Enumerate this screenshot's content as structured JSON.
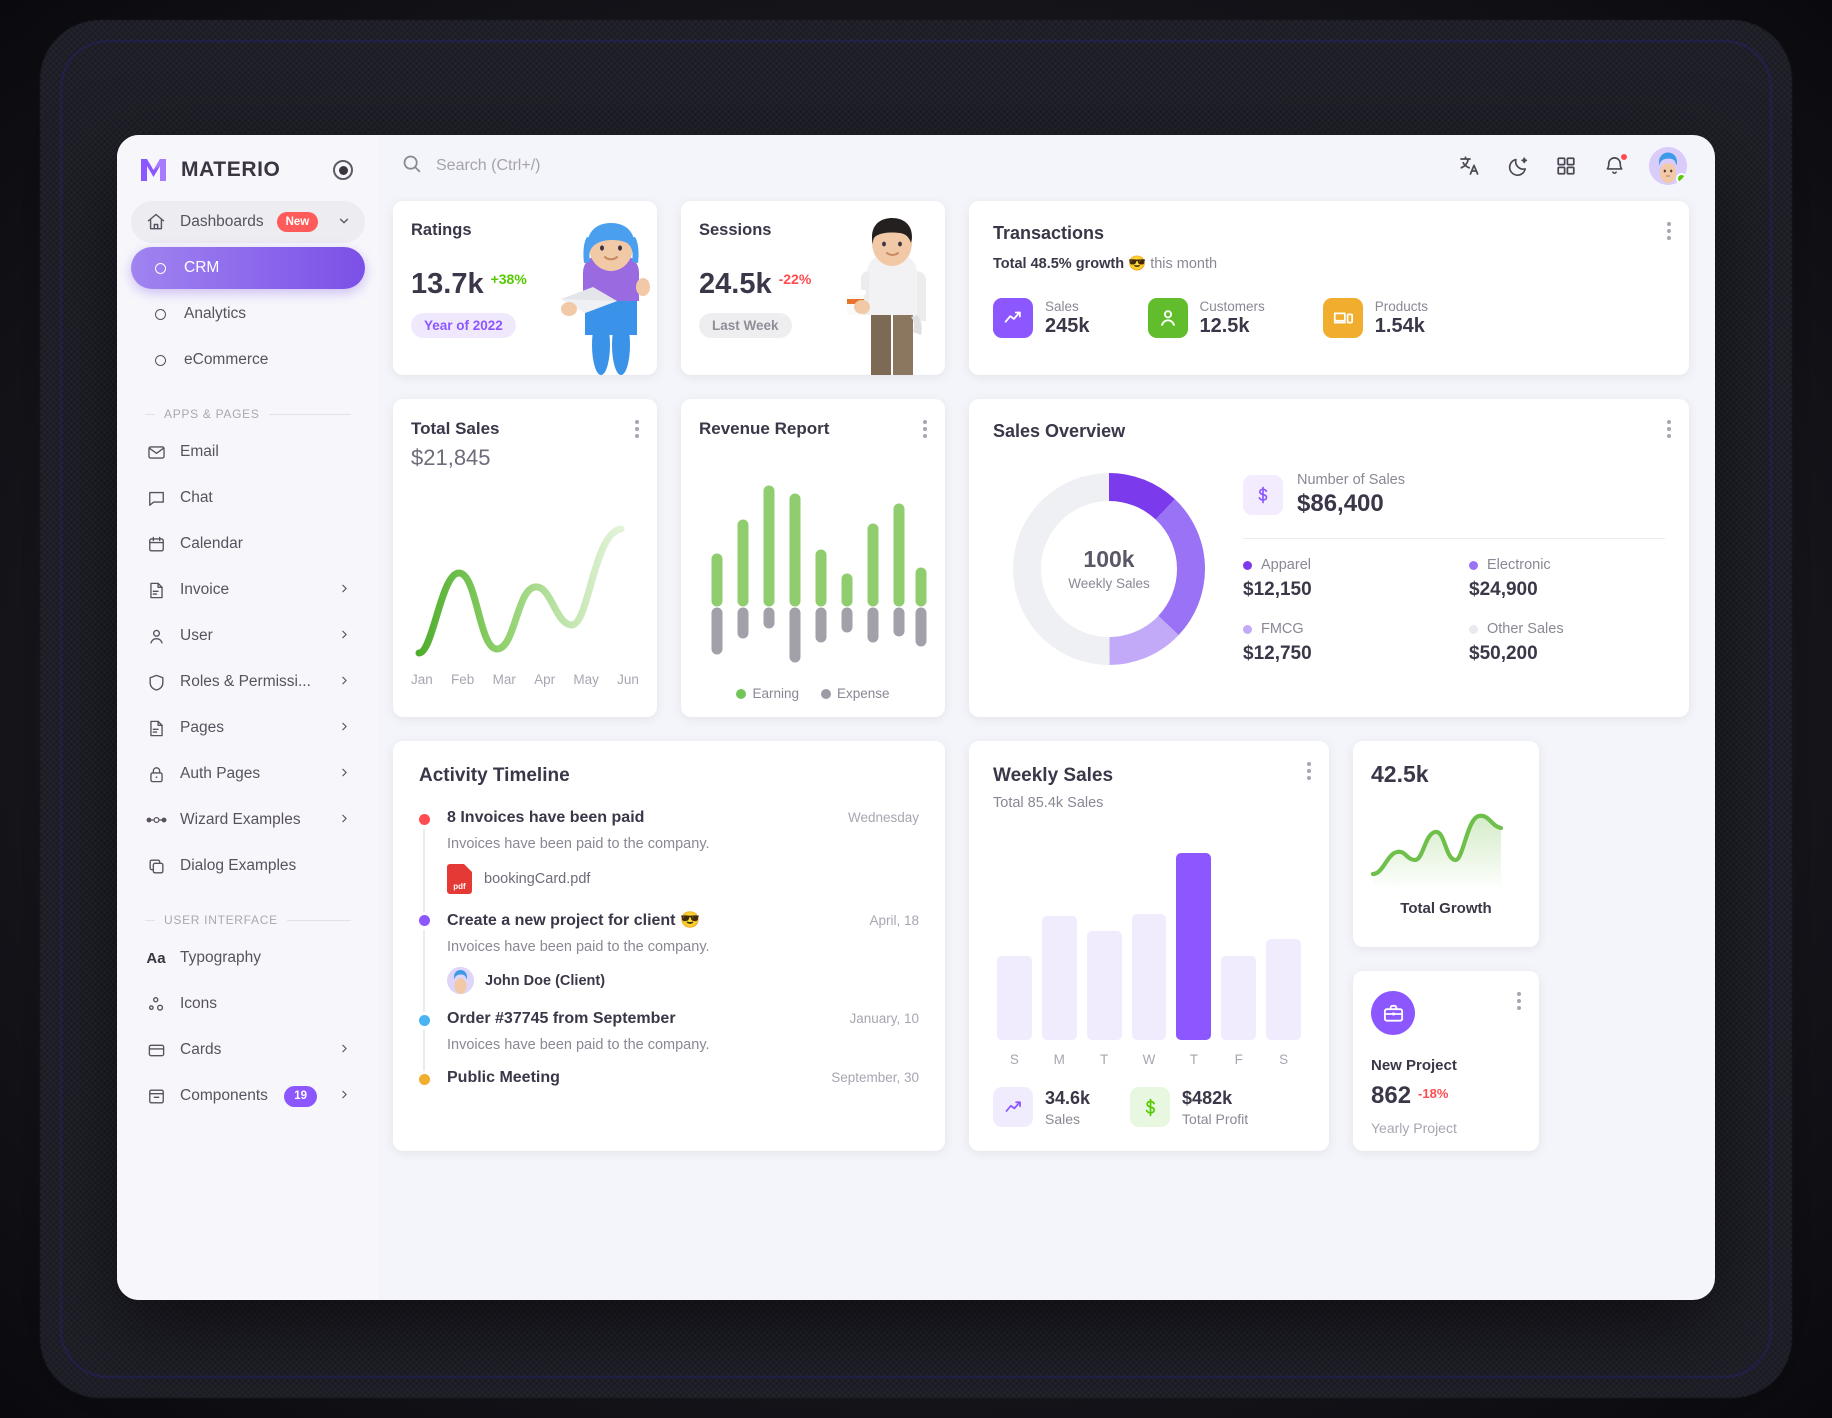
{
  "brand": {
    "name": "MATERIO",
    "pin_icon": "radio-pin-icon"
  },
  "search": {
    "placeholder": "Search (Ctrl+/)",
    "value": "",
    "icon": "search-icon"
  },
  "topbar": {
    "icons": [
      "translate-icon",
      "moon-icon",
      "grid-apps-icon",
      "bell-icon"
    ],
    "avatar": "user-avatar"
  },
  "sidebar": {
    "primary": [
      {
        "label": "Dashboards",
        "icon": "home-icon",
        "badge": "New",
        "chevron": "⌄",
        "state": "expanded"
      },
      {
        "label": "CRM",
        "icon": "circle-icon",
        "state": "active"
      },
      {
        "label": "Analytics",
        "icon": "circle-icon"
      },
      {
        "label": "eCommerce",
        "icon": "circle-icon"
      }
    ],
    "caption_apps": "APPS & PAGES",
    "apps": [
      {
        "label": "Email",
        "icon": "mail-icon"
      },
      {
        "label": "Chat",
        "icon": "chat-icon"
      },
      {
        "label": "Calendar",
        "icon": "calendar-icon"
      },
      {
        "label": "Invoice",
        "icon": "file-icon",
        "chevron": "›"
      },
      {
        "label": "User",
        "icon": "person-icon",
        "chevron": "›"
      },
      {
        "label": "Roles & Permissi...",
        "icon": "shield-icon",
        "chevron": "›"
      },
      {
        "label": "Pages",
        "icon": "file-icon",
        "chevron": "›"
      },
      {
        "label": "Auth Pages",
        "icon": "lock-icon",
        "chevron": "›"
      },
      {
        "label": "Wizard Examples",
        "icon": "wizard-dots-icon",
        "chevron": "›"
      },
      {
        "label": "Dialog Examples",
        "icon": "copy-icon"
      }
    ],
    "caption_ui": "USER INTERFACE",
    "ui": [
      {
        "label": "Typography",
        "icon": "typography-aa-icon"
      },
      {
        "label": "Icons",
        "icon": "icons-dots-icon"
      },
      {
        "label": "Cards",
        "icon": "card-icon",
        "chevron": "›"
      },
      {
        "label": "Components",
        "icon": "components-icon",
        "badge": "19",
        "chevron": "›"
      }
    ]
  },
  "ratings": {
    "title": "Ratings",
    "value": "13.7k",
    "delta": "+38%",
    "delta_color": "#56ca00",
    "pill": "Year of 2022",
    "illustration": "woman-with-laptop-3d"
  },
  "sessions": {
    "title": "Sessions",
    "value": "24.5k",
    "delta": "-22%",
    "delta_color": "#ff4c51",
    "pill": "Last Week",
    "illustration": "man-with-coffee-3d"
  },
  "transactions": {
    "title": "Transactions",
    "subtitle_bold": "Total 48.5% growth",
    "subtitle_emoji": "😎",
    "subtitle_rest": "this month",
    "stats": [
      {
        "label": "Sales",
        "value": "245k",
        "color": "#8c57ff",
        "icon": "trending-up-icon"
      },
      {
        "label": "Customers",
        "value": "12.5k",
        "color": "#56ca00",
        "icon": "person-icon"
      },
      {
        "label": "Products",
        "value": "1.54k",
        "color": "#f0ad2e",
        "icon": "devices-icon"
      }
    ]
  },
  "total_sales": {
    "title": "Total Sales",
    "amount": "$21,845"
  },
  "revenue_report": {
    "title": "Revenue Report",
    "legend": [
      {
        "label": "Earning",
        "color": "#72c55b"
      },
      {
        "label": "Expense",
        "color": "#9e9aa6"
      }
    ]
  },
  "sales_overview": {
    "title": "Sales Overview",
    "center_value": "100k",
    "center_label": "Weekly Sales",
    "number_of_sales_label": "Number of Sales",
    "number_of_sales_value": "$86,400",
    "dollar_icon": "dollar-icon",
    "categories": [
      {
        "label": "Apparel",
        "value": "$12,150",
        "color": "#7c3aed"
      },
      {
        "label": "Electronic",
        "value": "$24,900",
        "color": "#9a72f5"
      },
      {
        "label": "FMCG",
        "value": "$12,750",
        "color": "#c3aaf9"
      },
      {
        "label": "Other Sales",
        "value": "$50,200",
        "color": "#eff0f4"
      }
    ]
  },
  "activity_timeline": {
    "title": "Activity Timeline",
    "items": [
      {
        "title": "8 Invoices have been paid",
        "time": "Wednesday",
        "dot_color": "#ff4c51",
        "desc": "Invoices have been paid to the company.",
        "attachment": "bookingCard.pdf",
        "attachment_icon": "pdf-icon"
      },
      {
        "title": "Create a new project for client 😎",
        "time": "April, 18",
        "dot_color": "#8c57ff",
        "desc": "Invoices have been paid to the company.",
        "person": "John Doe (Client)",
        "person_avatar": "client-avatar"
      },
      {
        "title": "Order #37745 from September",
        "time": "January, 10",
        "dot_color": "#4ab3f4",
        "desc": "Invoices have been paid to the company."
      },
      {
        "title": "Public Meeting",
        "time": "September, 30",
        "dot_color": "#f0ad2e"
      }
    ]
  },
  "weekly_sales": {
    "title": "Weekly Sales",
    "subtitle": "Total 85.4k Sales",
    "stats": [
      {
        "value": "34.6k",
        "label": "Sales",
        "icon": "trending-up-icon",
        "color": "#8c57ff",
        "bg": "#f0ecfd"
      },
      {
        "value": "$482k",
        "label": "Total Profit",
        "icon": "dollar-icon",
        "color": "#56ca00",
        "bg": "#e8f7e0"
      }
    ]
  },
  "total_growth": {
    "value": "42.5k",
    "caption": "Total Growth",
    "line_color": "#72c55b"
  },
  "new_project": {
    "icon": "briefcase-icon",
    "name": "New Project",
    "value": "862",
    "delta": "-18%",
    "caption": "Yearly Project"
  },
  "chart_data": [
    {
      "type": "line",
      "name": "total-sales-sparkline",
      "title": "Total Sales",
      "categories": [
        "Jan",
        "Feb",
        "Mar",
        "Apr",
        "May",
        "Jun"
      ],
      "values": [
        5,
        78,
        12,
        62,
        30,
        100
      ],
      "ylim": [
        0,
        100
      ],
      "xlabel": "",
      "ylabel": "",
      "grid": false,
      "legend": "none",
      "color": "#72c55b"
    },
    {
      "type": "bar",
      "name": "revenue-report",
      "title": "Revenue Report",
      "categories": [
        "1",
        "2",
        "3",
        "4",
        "5",
        "6",
        "7",
        "8",
        "9"
      ],
      "series": [
        {
          "name": "Earning",
          "values": [
            30,
            52,
            80,
            72,
            33,
            18,
            50,
            68,
            22
          ],
          "color": "#72c55b"
        },
        {
          "name": "Expense",
          "values": [
            -34,
            -20,
            -12,
            -45,
            -22,
            -14,
            -22,
            -18,
            -26
          ],
          "color": "#9e9aa6"
        }
      ],
      "ylim": [
        -50,
        90
      ],
      "grid": false,
      "legend": "bottom"
    },
    {
      "type": "pie",
      "name": "sales-overview-donut",
      "title": "Sales Overview",
      "labels": [
        "Apparel",
        "Electronic",
        "FMCG",
        "Other Sales"
      ],
      "values": [
        12150,
        24900,
        12750,
        50200
      ],
      "colors": [
        "#7c3aed",
        "#9a72f5",
        "#c3aaf9",
        "#eff0f4"
      ],
      "center_text": "100k",
      "center_sub": "Weekly Sales",
      "legend": "right"
    },
    {
      "type": "bar",
      "name": "weekly-sales",
      "title": "Weekly Sales",
      "categories": [
        "S",
        "M",
        "T",
        "W",
        "T",
        "F",
        "S"
      ],
      "values": [
        45,
        66,
        58,
        67,
        100,
        45,
        54
      ],
      "highlight_index": 4,
      "ylim": [
        0,
        100
      ],
      "grid": false,
      "legend": "none",
      "colors": {
        "base": "#f0ecfd",
        "highlight": "#8c57ff"
      }
    },
    {
      "type": "area",
      "name": "total-growth-sparkline",
      "title": "Total Growth",
      "values": [
        20,
        40,
        48,
        40,
        72,
        76,
        46,
        92,
        84,
        86
      ],
      "ylim": [
        0,
        100
      ],
      "grid": false,
      "legend": "none",
      "color": "#72c55b"
    }
  ]
}
